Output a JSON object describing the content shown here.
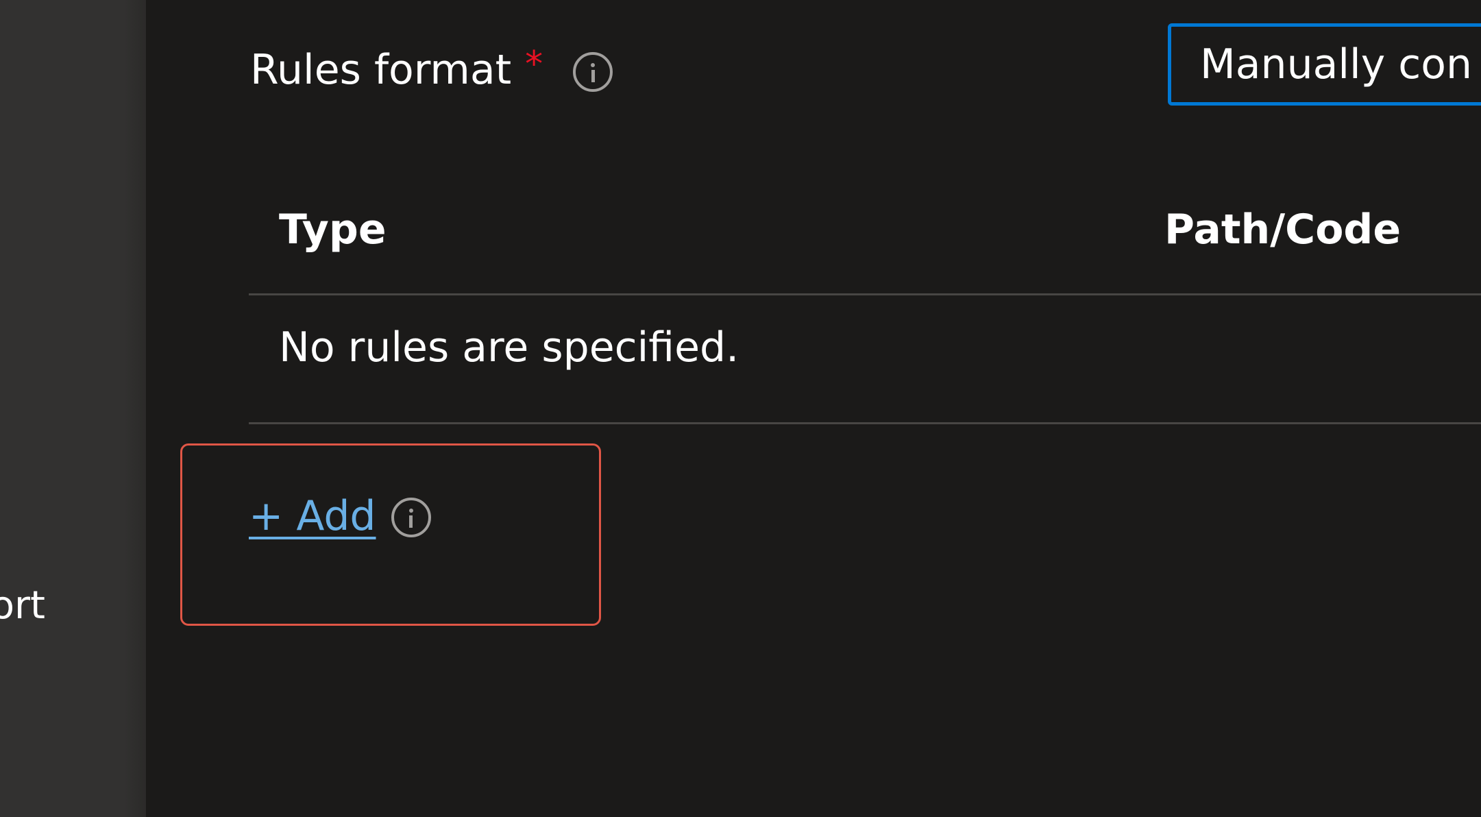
{
  "sidebar": {
    "partial_label": "ort"
  },
  "form": {
    "rules_format": {
      "label": "Rules format",
      "required_marker": "*",
      "selected_value": "Manually con"
    }
  },
  "rules_table": {
    "columns": [
      "Type",
      "Path/Code"
    ],
    "empty_message": "No rules are specified."
  },
  "actions": {
    "add_label": "+ Add"
  },
  "colors": {
    "accent": "#0078d4",
    "link": "#69afe5",
    "required": "#e81123",
    "highlight": "#e05646"
  },
  "icons": {
    "rules_format_info": "info-icon",
    "add_info": "info-icon"
  }
}
